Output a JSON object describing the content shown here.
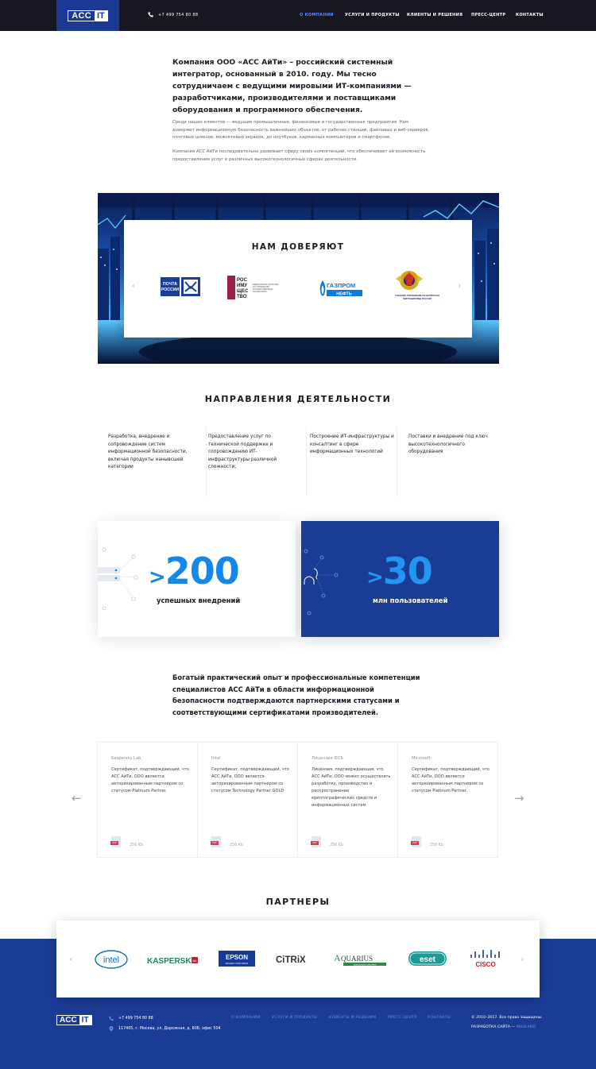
{
  "header": {
    "logo_left": "ACC",
    "logo_right": "IT",
    "phone": "+7 499 754 80 88",
    "nav": [
      {
        "label": "О компании",
        "active": true
      },
      {
        "label": "Услуги и продукты",
        "active": false
      },
      {
        "label": "Клиенты и решения",
        "active": false
      },
      {
        "label": "Пресс-центр",
        "active": false
      },
      {
        "label": "Контакты",
        "active": false
      }
    ]
  },
  "intro": {
    "lead": "Компания ООО «АСС АйТи» – российский системный интегратор, основанный в 2010. году. Мы тесно сотрудничаем с ведущими мировыми ИТ-компаниями — разработчиками, производителями и  поставщиками оборудования и программного обеспечения.",
    "p1": "Среди наших клиентов — ведущие промышленные, финансовые и государственные предприятия. Нам доверяют информационную безопасность важнейших объектов: от рабочих станций, файловых и веб-серверов, почтовых шлюзов, межсетевых экранов, до ноутбуков, карманных компьютеров и смартфонов.",
    "p2": "Компания АСС АйТи последовательно развивает сферу своих компетенций, что обеспечивает ей возможность предоставления услуг в различных высокотехнологичных сферах деятельности."
  },
  "trust": {
    "title": "НАМ ДОВЕРЯЮТ",
    "logos": {
      "pochta": [
        "ПОЧТА",
        "РОССИИ"
      ],
      "rosimushchestvo": [
        "РОС",
        "ИМУ",
        "ЩЕС",
        "ТВО"
      ],
      "rosimushchestvo_caption": [
        "ФЕДЕРАЛЬНОЕ АГЕНТСТВО",
        "ПО УПРАВЛЕНИЮ",
        "ГОСУДАРСТВЕННЫМ",
        "ИМУЩЕСТВОМ"
      ],
      "gazprom": [
        "ГАЗПРОМ",
        "НЕФТЬ"
      ],
      "mvd_caption": [
        "ГЛАВНОЕ УПРАВЛЕНИЕ ПО ВОПРОСАМ",
        "МИГРАЦИИ МВД РОССИИ"
      ]
    },
    "icons": [
      "chevron-left-icon",
      "chevron-right-icon"
    ]
  },
  "directions": {
    "title": "НАПРАВЛЕНИЯ ДЕЯТЕЛЬНОСТИ",
    "items": [
      "Разработка, внедрение и сопровождение систем информационной безопасности, включая продукты нанывсшей категории",
      "Предоставление услуг по технической поддержке и сопровождению ИТ-инфраструктуры различной сложности;",
      "Построение ИТ-инфраструктуры и консалтинг в сфере информационных технологий",
      "Поставки и внедрение под ключ высокотехнологичного оборудования"
    ]
  },
  "stats": [
    {
      "prefix": ">",
      "number": "200",
      "label": "успешных внедрений"
    },
    {
      "prefix": ">",
      "number": "30",
      "label": "млн пользователей"
    }
  ],
  "experience": "Богатый практический опыт и профессиональные компетенции специалистов АСС АйТи в области информационной безопасности подтверждаются партнерскими статусами и соответствующими сертификатами производителей.",
  "certificates": [
    {
      "vendor": "Kaspersky Lab",
      "text": "Сертификат, подтверждающий, что АСС АйТи, ООО является авторизированным партнером со статусом Platinum Partner.",
      "file_type": "PDF",
      "size": "256 Kb"
    },
    {
      "vendor": "Intel",
      "text": "Сертификат, подтверждающий, что АСС АйТи, ООО является авторизированным партнером со статусом Technology Partner GOLD",
      "file_type": "PDF",
      "size": "256 Kb"
    },
    {
      "vendor": "Лицензия ФСБ",
      "text": "Лицензия, подтверждающая, что АСС АйТи, ООО может осуществлять разработку, производство и распространение криптографических средств  и  информационных систем",
      "file_type": "PDF",
      "size": "256 Kb"
    },
    {
      "vendor": "Microsoft",
      "text": "Сертификат, подтверждающий, что АСС АйТи, ООО является авторизированным партнером со статусом Platinum Partner.",
      "file_type": "PDF",
      "size": "256 Kb"
    }
  ],
  "partners": {
    "title": "ПАРТНЕРЫ",
    "logos": {
      "intel": "intel",
      "kaspersky": "KASPERSKY",
      "kaspersky_badge": "lab",
      "epson": "EPSON",
      "epson_tagline": "EXCEED YOUR VISION",
      "citrix": "CiTRiX",
      "aquarius_a": "A",
      "aquarius_rest": "QUARIUS",
      "aquarius_tagline": "компьютеры и решения",
      "eset": "eset",
      "cisco": "CISCO"
    }
  },
  "footer": {
    "logo_left": "ACC",
    "logo_right": "IT",
    "phone": "+7 499 754 80 88",
    "address": "117405, г. Москва, ул. Дорожная, д. 60Б, офис 504",
    "nav": [
      "О компании",
      "Услуги и продукты",
      "Клиенты и решения",
      "Пресс-центр",
      "Контакты"
    ],
    "copyright": "© 2010–2017. Все права защищены.",
    "dev_label": "Разработка сайта —",
    "dev_name": "NIKOLAND"
  },
  "colors": {
    "header_bg": "#171722",
    "brand_blue": "#1b3c94",
    "accent": "#1687ea",
    "nav_active": "#5c86ff"
  }
}
